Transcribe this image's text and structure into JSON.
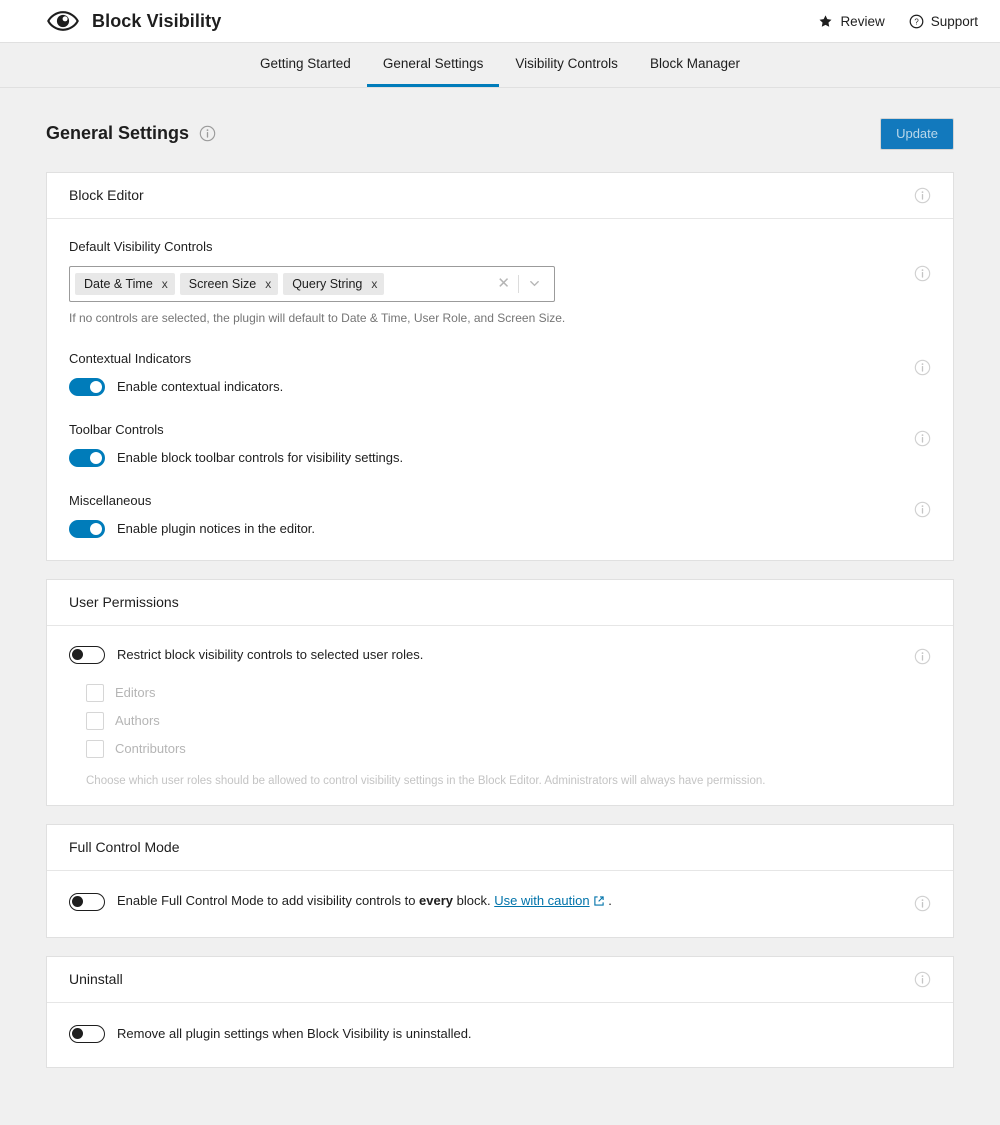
{
  "header": {
    "logo_icon": "eye-icon",
    "brand_title": "Block Visibility",
    "links": [
      {
        "label": "Review",
        "icon": "star-icon"
      },
      {
        "label": "Support",
        "icon": "question-circle-icon"
      }
    ]
  },
  "tabs": [
    {
      "label": "Getting Started",
      "active": false
    },
    {
      "label": "General Settings",
      "active": true
    },
    {
      "label": "Visibility Controls",
      "active": false
    },
    {
      "label": "Block Manager",
      "active": false
    }
  ],
  "page": {
    "title": "General Settings",
    "title_info_icon": "info-icon",
    "update_label": "Update"
  },
  "block_editor": {
    "panel_title": "Block Editor",
    "panel_info_icon": "info-icon",
    "default_controls": {
      "label": "Default Visibility Controls",
      "tokens": [
        "Date & Time",
        "Screen Size",
        "Query String"
      ],
      "token_remove_glyph": "x",
      "clear_all_icon": "close-icon",
      "dropdown_icon": "chevron-down-icon",
      "help": "If no controls are selected, the plugin will default to Date & Time, User Role, and Screen Size."
    },
    "contextual_indicators": {
      "label": "Contextual Indicators",
      "toggle_label": "Enable contextual indicators.",
      "enabled": true
    },
    "toolbar_controls": {
      "label": "Toolbar Controls",
      "toggle_label": "Enable block toolbar controls for visibility settings.",
      "enabled": true
    },
    "miscellaneous": {
      "label": "Miscellaneous",
      "toggle_label": "Enable plugin notices in the editor.",
      "enabled": true
    }
  },
  "user_permissions": {
    "panel_title": "User Permissions",
    "restrict_toggle_label": "Restrict block visibility controls to selected user roles.",
    "restrict_enabled": false,
    "roles": [
      {
        "label": "Editors",
        "checked": false
      },
      {
        "label": "Authors",
        "checked": false
      },
      {
        "label": "Contributors",
        "checked": false
      }
    ],
    "help": "Choose which user roles should be allowed to control visibility settings in the Block Editor. Administrators will always have permission."
  },
  "full_control_mode": {
    "panel_title": "Full Control Mode",
    "toggle_label_part1": "Enable Full Control Mode to add visibility controls to ",
    "toggle_label_bold": "every",
    "toggle_label_part2": " block. ",
    "link_label": "Use with caution",
    "link_icon": "external-link-icon",
    "trailing": " .",
    "enabled": false
  },
  "uninstall": {
    "panel_title": "Uninstall",
    "panel_info_icon": "info-icon",
    "toggle_label": "Remove all plugin settings when Block Visibility is uninstalled.",
    "enabled": false
  },
  "colors": {
    "accent": "#007cba",
    "button": "#1279bd",
    "link": "#0073aa",
    "page_bg": "#f0f0f0",
    "panel_bg": "#ffffff",
    "border": "#e0e0e0",
    "muted_text": "#757575"
  }
}
